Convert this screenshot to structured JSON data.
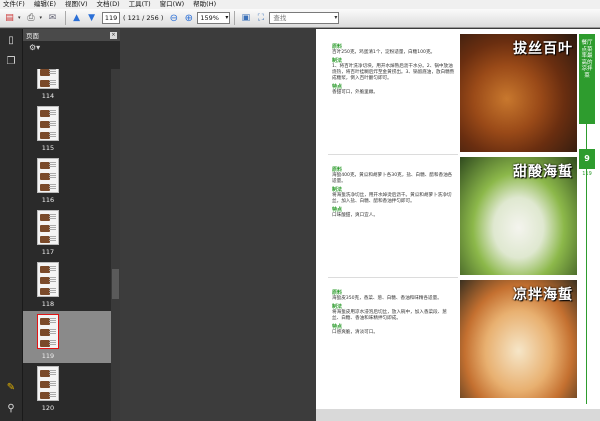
{
  "menu": [
    "文件(F)",
    "编辑(E)",
    "视图(V)",
    "文档(D)",
    "工具(T)",
    "窗口(W)",
    "帮助(H)"
  ],
  "toolbar": {
    "page_number": "119",
    "page_count": "( 121 / 256 )",
    "zoom": "159%",
    "search_placeholder": "查找"
  },
  "panel": {
    "title": "页面",
    "close_label": "×"
  },
  "thumbnails": [
    {
      "label": "114"
    },
    {
      "label": "115"
    },
    {
      "label": "116"
    },
    {
      "label": "117"
    },
    {
      "label": "118"
    },
    {
      "label": "119",
      "selected": true
    },
    {
      "label": "120"
    }
  ],
  "document": {
    "side_tab_text": "餐厅点菜率最高的凉拌菜",
    "side_tab_number": "9",
    "side_page_number": "119",
    "sections": [
      {
        "title": "拔丝百叶",
        "heading1": "原料",
        "ingredients": "百叶250克，鸡蛋清1个，淀粉适量，白糖100克。",
        "heading2": "制法",
        "steps": "1、将百叶洗净切块，用开水焯熟后沥干水分。2、锅中放油烧热，将百叶挂糊后炸至金黄捞出。3、锅留底油，放白糖熬成糖浆，倒入百叶翻匀即可。",
        "heading3": "特点",
        "feature": "香甜可口，外脆里嫩。"
      },
      {
        "title": "甜酸海蜇",
        "heading1": "原料",
        "ingredients": "海蜇400克，黄瓜和胡萝卜各30克，盐、白糖、醋和香油各适量。",
        "heading2": "制法",
        "steps": "将海蜇洗净切丝，用开水焯烫后沥干。黄瓜和胡萝卜洗净切丝，加入盐、白糖、醋和香油拌匀即可。",
        "heading3": "特点",
        "feature": "口味酸甜，爽口宜人。"
      },
      {
        "title": "凉拌海蜇",
        "heading1": "原料",
        "ingredients": "海蜇皮350克，香菜、葱、白糖、香油和味精各适量。",
        "heading2": "制法",
        "steps": "将海蜇皮用凉水浸泡后切丝，放入碗中，加入香菜段、葱丝、白糖、香油和味精拌匀即成。",
        "heading3": "特点",
        "feature": "口感爽脆，清淡可口。"
      }
    ]
  },
  "colors": {
    "accent_green": "#2e9c2e",
    "selection_red": "#e21414"
  }
}
